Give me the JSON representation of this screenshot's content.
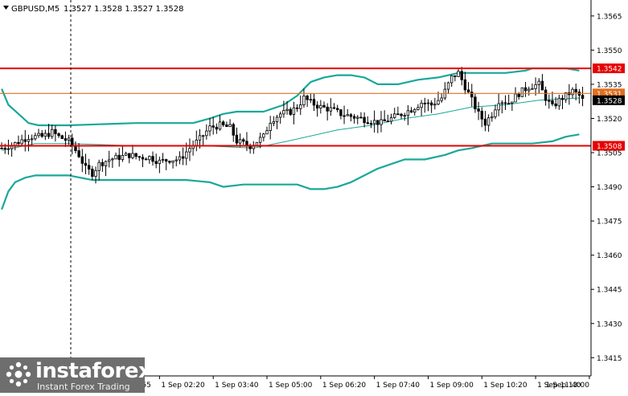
{
  "header": {
    "symbol": "GBPUSD,M5",
    "ohlc": "1.3527 1.3528 1.3527 1.3528"
  },
  "watermark": {
    "brand": "instaforex",
    "tagline": "Instant Forex Trading",
    "colors": {
      "background": "#6e6e6e",
      "text": "#ffffff"
    }
  },
  "chart_data": {
    "type": "candlestick",
    "ylim": [
      1.3407,
      1.3572
    ],
    "y_ticks": [
      "1.3565",
      "1.3550",
      "1.3535",
      "1.3520",
      "1.3505",
      "1.3490",
      "1.3475",
      "1.3460",
      "1.3445",
      "1.3430",
      "1.3415"
    ],
    "x_ticks": [
      "1 Sep 00:55",
      "1 Sep 02:20",
      "1 Sep 03:40",
      "1 Sep 05:00",
      "1 Sep 06:20",
      "1 Sep 07:40",
      "1 Sep 09:00",
      "1 Sep 10:20",
      "1 Sep 11:40",
      "1 Sep 13:00"
    ],
    "levels": [
      {
        "label": "1.3542",
        "value": 1.3542,
        "color": "#e60000"
      },
      {
        "label": "1.3531",
        "value": 1.3531,
        "color": "#e07020"
      },
      {
        "label": "1.3508",
        "value": 1.3508,
        "color": "#e60000"
      }
    ],
    "current_price": {
      "label": "1.3528",
      "value": 1.3528
    },
    "close_path": [
      [
        0,
        1.3507
      ],
      [
        4,
        1.3509
      ],
      [
        8,
        1.3512
      ],
      [
        12,
        1.3512
      ],
      [
        15,
        1.3514
      ],
      [
        17,
        1.3512
      ],
      [
        20,
        1.351
      ],
      [
        23,
        1.3504
      ],
      [
        25,
        1.3498
      ],
      [
        27,
        1.3496
      ],
      [
        29,
        1.35
      ],
      [
        32,
        1.3502
      ],
      [
        35,
        1.3503
      ],
      [
        38,
        1.3504
      ],
      [
        41,
        1.3503
      ],
      [
        44,
        1.3503
      ],
      [
        47,
        1.3501
      ],
      [
        50,
        1.3502
      ],
      [
        53,
        1.3502
      ],
      [
        56,
        1.3507
      ],
      [
        59,
        1.3511
      ],
      [
        62,
        1.3516
      ],
      [
        65,
        1.3517
      ],
      [
        68,
        1.3516
      ],
      [
        70,
        1.351
      ],
      [
        72,
        1.3509
      ],
      [
        74,
        1.3508
      ],
      [
        76,
        1.351
      ],
      [
        78,
        1.3512
      ],
      [
        80,
        1.3519
      ],
      [
        83,
        1.3522
      ],
      [
        86,
        1.3523
      ],
      [
        88,
        1.3525
      ],
      [
        90,
        1.3529
      ],
      [
        92,
        1.3527
      ],
      [
        95,
        1.3525
      ],
      [
        98,
        1.3524
      ],
      [
        101,
        1.3522
      ],
      [
        104,
        1.3521
      ],
      [
        107,
        1.352
      ],
      [
        110,
        1.3519
      ],
      [
        113,
        1.3518
      ],
      [
        116,
        1.352
      ],
      [
        119,
        1.3522
      ],
      [
        122,
        1.3524
      ],
      [
        125,
        1.3527
      ],
      [
        128,
        1.3526
      ],
      [
        131,
        1.3529
      ],
      [
        134,
        1.3538
      ],
      [
        136,
        1.354
      ],
      [
        138,
        1.3534
      ],
      [
        140,
        1.3528
      ],
      [
        142,
        1.3522
      ],
      [
        144,
        1.3518
      ],
      [
        146,
        1.3522
      ],
      [
        148,
        1.3528
      ],
      [
        151,
        1.3527
      ],
      [
        154,
        1.3531
      ],
      [
        157,
        1.3534
      ],
      [
        160,
        1.3535
      ],
      [
        162,
        1.3529
      ],
      [
        164,
        1.3525
      ],
      [
        166,
        1.3528
      ],
      [
        168,
        1.353
      ],
      [
        170,
        1.3532
      ],
      [
        172,
        1.353
      ],
      [
        173,
        1.3528
      ]
    ],
    "bands": {
      "upper": [
        [
          0,
          1.3533
        ],
        [
          2,
          1.3526
        ],
        [
          5,
          1.3522
        ],
        [
          8,
          1.3518
        ],
        [
          11,
          1.3517
        ],
        [
          20,
          1.3517
        ],
        [
          40,
          1.3518
        ],
        [
          57,
          1.3518
        ],
        [
          62,
          1.352
        ],
        [
          66,
          1.3522
        ],
        [
          70,
          1.3523
        ],
        [
          78,
          1.3523
        ],
        [
          84,
          1.3526
        ],
        [
          88,
          1.353
        ],
        [
          92,
          1.3536
        ],
        [
          96,
          1.3538
        ],
        [
          100,
          1.3539
        ],
        [
          104,
          1.3539
        ],
        [
          108,
          1.3538
        ],
        [
          112,
          1.3535
        ],
        [
          118,
          1.3535
        ],
        [
          124,
          1.3537
        ],
        [
          130,
          1.3538
        ],
        [
          136,
          1.354
        ],
        [
          150,
          1.354
        ],
        [
          156,
          1.3541
        ],
        [
          158,
          1.3542
        ],
        [
          168,
          1.3542
        ],
        [
          172,
          1.3541
        ]
      ],
      "middle": [
        [
          0,
          1.3506
        ],
        [
          10,
          1.3509
        ],
        [
          20,
          1.3509
        ],
        [
          40,
          1.3508
        ],
        [
          60,
          1.3508
        ],
        [
          75,
          1.3507
        ],
        [
          85,
          1.351
        ],
        [
          100,
          1.3515
        ],
        [
          110,
          1.3517
        ],
        [
          120,
          1.352
        ],
        [
          130,
          1.3522
        ],
        [
          140,
          1.3525
        ],
        [
          150,
          1.3526
        ],
        [
          160,
          1.3528
        ],
        [
          172,
          1.3529
        ]
      ],
      "lower": [
        [
          0,
          1.348
        ],
        [
          2,
          1.3488
        ],
        [
          4,
          1.3492
        ],
        [
          7,
          1.3494
        ],
        [
          10,
          1.3495
        ],
        [
          20,
          1.3495
        ],
        [
          27,
          1.3493
        ],
        [
          40,
          1.3493
        ],
        [
          55,
          1.3493
        ],
        [
          62,
          1.3492
        ],
        [
          66,
          1.349
        ],
        [
          72,
          1.3491
        ],
        [
          80,
          1.3491
        ],
        [
          88,
          1.3491
        ],
        [
          92,
          1.3489
        ],
        [
          96,
          1.3489
        ],
        [
          100,
          1.349
        ],
        [
          104,
          1.3492
        ],
        [
          108,
          1.3495
        ],
        [
          112,
          1.3498
        ],
        [
          116,
          1.35
        ],
        [
          120,
          1.3502
        ],
        [
          126,
          1.3502
        ],
        [
          132,
          1.3504
        ],
        [
          136,
          1.3506
        ],
        [
          140,
          1.3507
        ],
        [
          146,
          1.3509
        ],
        [
          152,
          1.3509
        ],
        [
          158,
          1.3509
        ],
        [
          164,
          1.351
        ],
        [
          168,
          1.3512
        ],
        [
          172,
          1.3513
        ]
      ]
    },
    "colors": {
      "bollinger_upper_lower": "#1aa899",
      "bollinger_middle": "#1aa899",
      "candles": "#000000",
      "support_resistance": "#e60000",
      "current_level": "#e07020",
      "price_label_bg": "#000000",
      "level_label_bg": "#e60000"
    },
    "grid": false
  }
}
